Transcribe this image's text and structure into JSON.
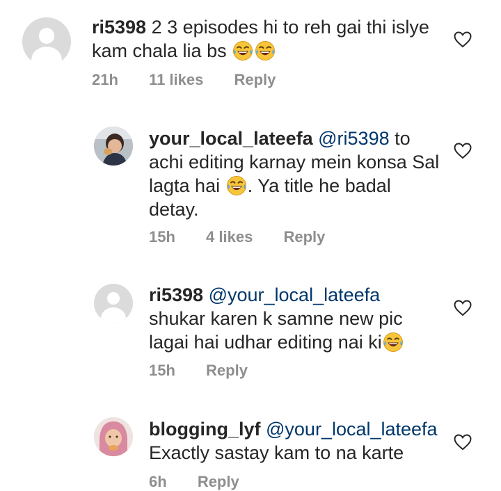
{
  "comments": [
    {
      "username": "ri5398",
      "mention": "",
      "text": "2 3 episodes hi to reh gai thi islye kam chala lia bs",
      "emojis": "😂😂",
      "time": "21h",
      "likes": "11 likes",
      "reply": "Reply",
      "avatar": "default-avatar"
    },
    {
      "username": "your_local_lateefa",
      "mention": "@ri5398",
      "text_a": "to achi editing karnay mein konsa Sal lagta hai",
      "emoji": "😂",
      "text_b": ". Ya title he badal detay.",
      "time": "15h",
      "likes": "4 likes",
      "reply": "Reply",
      "avatar": "profile-photo"
    },
    {
      "username": "ri5398",
      "mention": "@your_local_lateefa",
      "text": "shukar karen k samne new pic lagai hai udhar editing nai ki",
      "emoji": "😂",
      "time": "15h",
      "reply": "Reply",
      "avatar": "default-avatar"
    },
    {
      "username": "blogging_lyf",
      "mention": "@your_local_lateefa",
      "text": "Exactly sastay kam to na karte",
      "time": "6h",
      "reply": "Reply",
      "avatar": "profile-photo"
    }
  ],
  "icons": {
    "like": "heart-outline-icon",
    "emoji": "face-with-tears-of-joy-icon"
  },
  "colors": {
    "text": "#262626",
    "meta": "#8e8e8e",
    "mention": "#00376b",
    "avatar_default": "#dbdbdb"
  }
}
